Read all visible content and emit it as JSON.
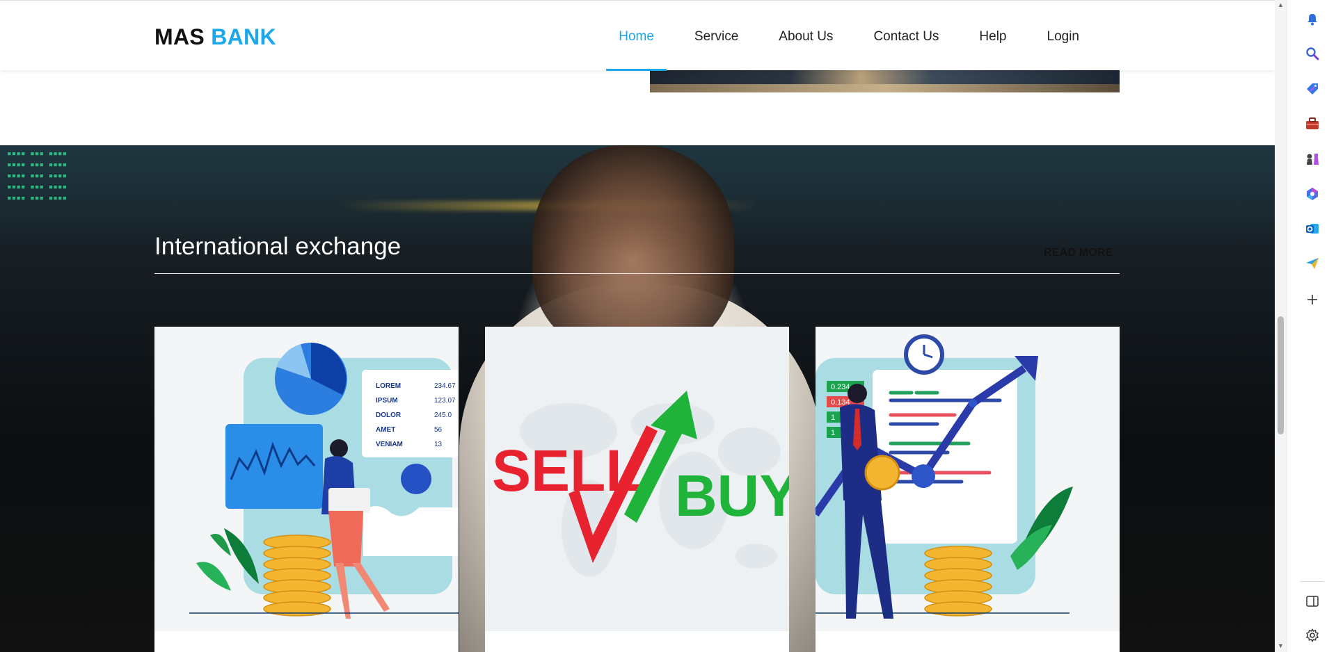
{
  "brand": {
    "first": "MAS",
    "second": "BANK"
  },
  "nav": [
    {
      "label": "Home",
      "active": true
    },
    {
      "label": "Service",
      "active": false
    },
    {
      "label": "About Us",
      "active": false
    },
    {
      "label": "Contact Us",
      "active": false
    },
    {
      "label": "Help",
      "active": false
    },
    {
      "label": "Login",
      "active": false
    }
  ],
  "hero": {
    "title": "International exchange",
    "read_more": "READ MORE"
  },
  "cards": [
    {
      "name": "investment-illustration",
      "labels": [
        "LOREM",
        "IPSUM",
        "DOLOR",
        "AMET",
        "VENIAM"
      ],
      "values": [
        "234.67",
        "123.07",
        "245.0",
        "56",
        "13"
      ]
    },
    {
      "name": "sell-buy-illustration",
      "sell": "SELL",
      "buy": "BUY"
    },
    {
      "name": "trader-illustration",
      "tickers": [
        "0.234",
        "0.134",
        "1",
        "1"
      ]
    }
  ],
  "colors": {
    "accent": "#1aa7ec",
    "sell": "#e8222f",
    "buy": "#1fb33a"
  },
  "sidebar_icons": [
    "bell-icon",
    "search-icon",
    "tag-icon",
    "briefcase-icon",
    "chess-icon",
    "copilot-icon",
    "outlook-icon",
    "send-icon",
    "plus-icon",
    "sidebar-toggle-icon",
    "settings-icon"
  ]
}
